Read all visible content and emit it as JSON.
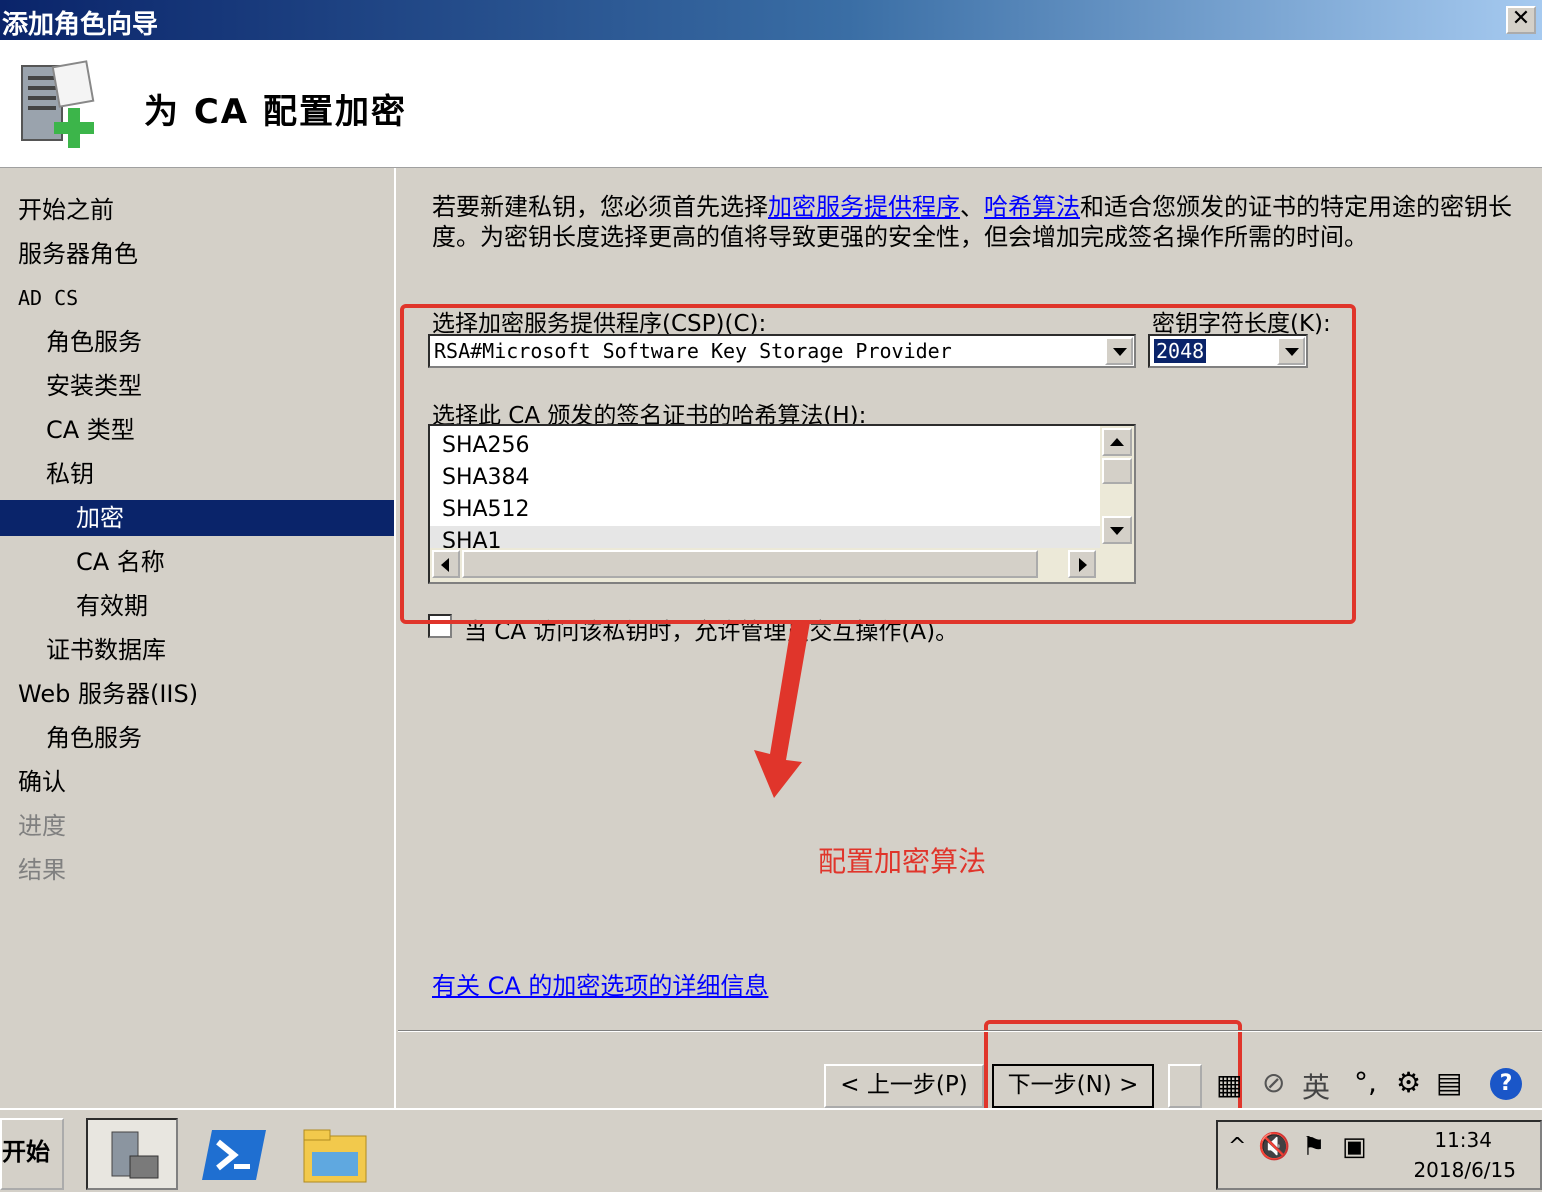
{
  "window": {
    "title": "添加角色向导",
    "close_label": "✕"
  },
  "header": {
    "page_title": "为 CA 配置加密",
    "icon": "server-add-icon"
  },
  "sidebar": {
    "items": [
      {
        "label": "开始之前"
      },
      {
        "label": "服务器角色"
      },
      {
        "label": "AD CS"
      },
      {
        "label": "角色服务"
      },
      {
        "label": "安装类型"
      },
      {
        "label": "CA 类型"
      },
      {
        "label": "私钥"
      },
      {
        "label": "加密"
      },
      {
        "label": "CA 名称"
      },
      {
        "label": "有效期"
      },
      {
        "label": "证书数据库"
      },
      {
        "label": "Web 服务器(IIS)"
      },
      {
        "label": "角色服务"
      },
      {
        "label": "确认"
      },
      {
        "label": "进度"
      },
      {
        "label": "结果"
      }
    ]
  },
  "content": {
    "intro_part1": "若要新建私钥，您必须首先选择",
    "intro_link1": "加密服务提供程序",
    "intro_part2": "、",
    "intro_link2": "哈希算法",
    "intro_part3": "和适合您颁发的证书的特定用途的密钥长度。为密钥长度选择更高的值将导致更强的安全性，但会增加完成签名操作所需的时间。",
    "csp_label": "选择加密服务提供程序(CSP)(C):",
    "csp_value": "RSA#Microsoft Software Key Storage Provider",
    "key_length_label": "密钥字符长度(K):",
    "key_length_value": "2048",
    "hash_label": "选择此 CA 颁发的签名证书的哈希算法(H):",
    "hash_options": [
      "SHA256",
      "SHA384",
      "SHA512",
      "SHA1"
    ],
    "admin_checkbox_label": "当 CA 访问该私钥时，允许管理员交互操作(A)。",
    "admin_checkbox_checked": false,
    "details_link": "有关 CA 的加密选项的详细信息"
  },
  "annotation": {
    "text": "配置加密算法",
    "color": "#e0352b"
  },
  "buttons": {
    "back": "< 上一步(P)",
    "next": "下一步(N) >"
  },
  "taskbar": {
    "start_label": "开始",
    "time": "11:34",
    "date": "2018/6/15",
    "ime_label": "英"
  },
  "colors": {
    "selection": "#0a246a",
    "dialog": "#d4d0c8",
    "link": "#0000ff"
  }
}
